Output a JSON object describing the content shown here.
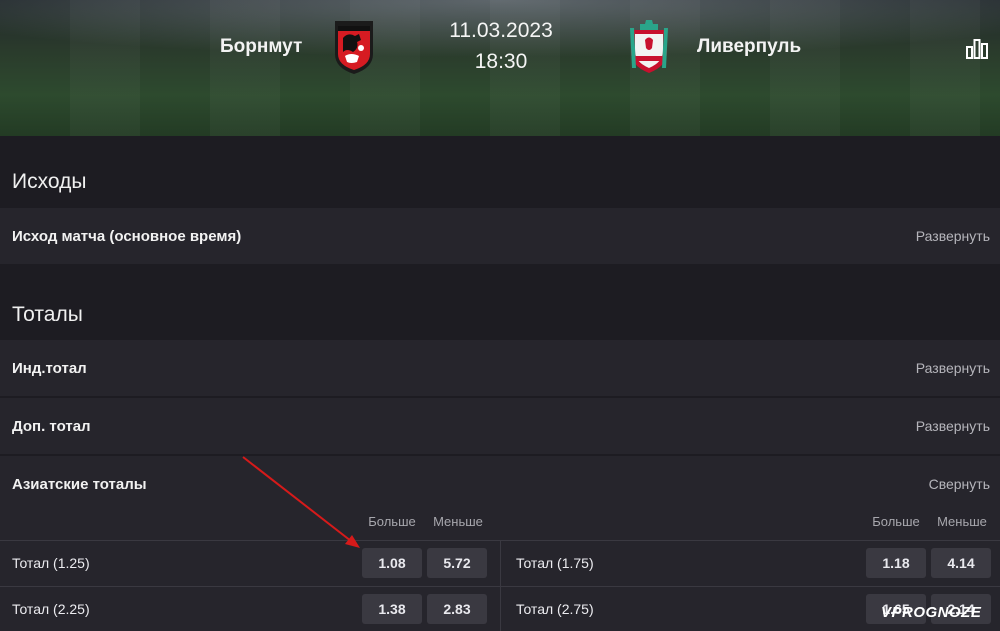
{
  "match": {
    "home_team": "Борнмут",
    "away_team": "Ливерпуль",
    "date": "11.03.2023",
    "time": "18:30"
  },
  "sections": {
    "outcomes_title": "Исходы",
    "totals_title": "Тоталы"
  },
  "rows": {
    "match_outcome": {
      "label": "Исход матча (основное время)",
      "action": "Развернуть"
    },
    "ind_total": {
      "label": "Инд.тотал",
      "action": "Развернуть"
    },
    "dop_total": {
      "label": "Доп. тотал",
      "action": "Развернуть"
    },
    "asian_totals": {
      "label": "Азиатские тоталы",
      "action": "Свернуть"
    }
  },
  "asian_table": {
    "col_over": "Больше",
    "col_under": "Меньше",
    "left": [
      {
        "label": "Тотал (1.25)",
        "over": "1.08",
        "under": "5.72"
      },
      {
        "label": "Тотал (2.25)",
        "over": "1.38",
        "under": "2.83"
      }
    ],
    "right": [
      {
        "label": "Тотал (1.75)",
        "over": "1.18",
        "under": "4.14"
      },
      {
        "label": "Тотал (2.75)",
        "over": "1.65",
        "under": "2.14"
      }
    ]
  },
  "watermark": "VPROGNOZE",
  "colors": {
    "background": "#1d1c22",
    "row_bg": "#26252c",
    "odd_button": "#3a3941",
    "arrow": "#d61a1a"
  },
  "icons": {
    "stats": "bar-chart-icon",
    "home_logo": "bournemouth-crest-icon",
    "away_logo": "liverpool-crest-icon"
  }
}
